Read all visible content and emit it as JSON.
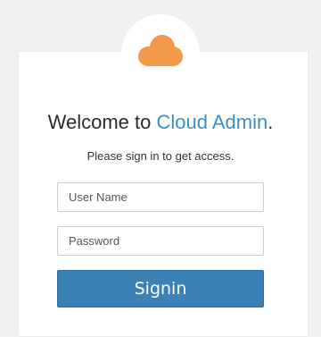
{
  "login": {
    "welcome_prefix": "Welcome to ",
    "brand_name": "Cloud Admin",
    "welcome_suffix": ".",
    "subtitle": "Please sign in to get access.",
    "username_placeholder": "User Name",
    "password_placeholder": "Password",
    "signin_label": "Signin"
  },
  "icons": {
    "logo": "cloud-icon"
  },
  "colors": {
    "brand_text": "#3e8ec4",
    "logo_cloud": "#f2994a",
    "button_bg": "#3a81b6"
  }
}
